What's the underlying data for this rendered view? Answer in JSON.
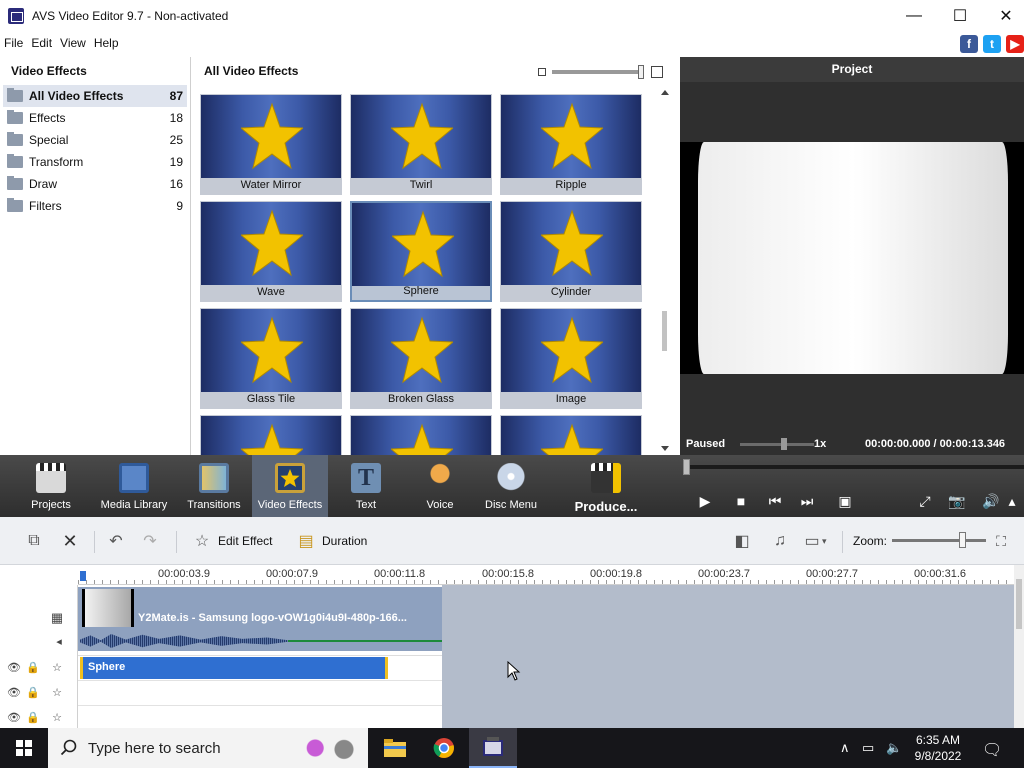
{
  "window": {
    "title": "AVS Video Editor 9.7 - Non-activated",
    "controls": {
      "minimize": "—",
      "maximize": "☐",
      "close": "✕"
    }
  },
  "menu": [
    "File",
    "Edit",
    "View",
    "Help"
  ],
  "social": [
    "f",
    "t",
    "▶"
  ],
  "left_panel": {
    "title": "Video Effects",
    "categories": [
      {
        "name": "All Video Effects",
        "count": "87",
        "selected": true
      },
      {
        "name": "Effects",
        "count": "18"
      },
      {
        "name": "Special",
        "count": "25"
      },
      {
        "name": "Transform",
        "count": "19"
      },
      {
        "name": "Draw",
        "count": "16"
      },
      {
        "name": "Filters",
        "count": "9"
      }
    ]
  },
  "grid": {
    "title": "All Video Effects",
    "tiles": [
      "Water Mirror",
      "Twirl",
      "Ripple",
      "Wave",
      "Sphere",
      "Cylinder",
      "Glass Tile",
      "Broken Glass",
      "Image",
      "",
      "",
      ""
    ],
    "selected": "Sphere"
  },
  "preview": {
    "title": "Project",
    "status": "Paused",
    "speed": "1x",
    "time": "00:00:00.000  /  00:00:13.346",
    "playback_position": 0.0
  },
  "toolbar": {
    "buttons": [
      "Projects",
      "Media Library",
      "Transitions",
      "Video Effects",
      "Text",
      "Voice",
      "Disc Menu",
      "Produce..."
    ],
    "active": "Video Effects"
  },
  "timeline_toolbar": {
    "edit_effect": "Edit Effect",
    "duration": "Duration",
    "zoom_label": "Zoom:"
  },
  "timeline": {
    "ruler": [
      "00:00:03.9",
      "00:00:07.9",
      "00:00:11.8",
      "00:00:15.8",
      "00:00:19.8",
      "00:00:23.7",
      "00:00:27.7",
      "00:00:31.6"
    ],
    "video_clip": "Y2Mate.is - Samsung logo-vOW1g0i4u9I-480p-166...",
    "effect_clip": "Sphere"
  },
  "taskbar": {
    "search_placeholder": "Type here to search",
    "time": "6:35 AM",
    "date": "9/8/2022"
  },
  "colors": {
    "accent": "#2f6fd1",
    "toolbar_bg": "#3a3a3a",
    "tile_blue": "#3c5aa8",
    "star_yellow": "#f2c200",
    "clip_blue": "#8ea1bf"
  }
}
